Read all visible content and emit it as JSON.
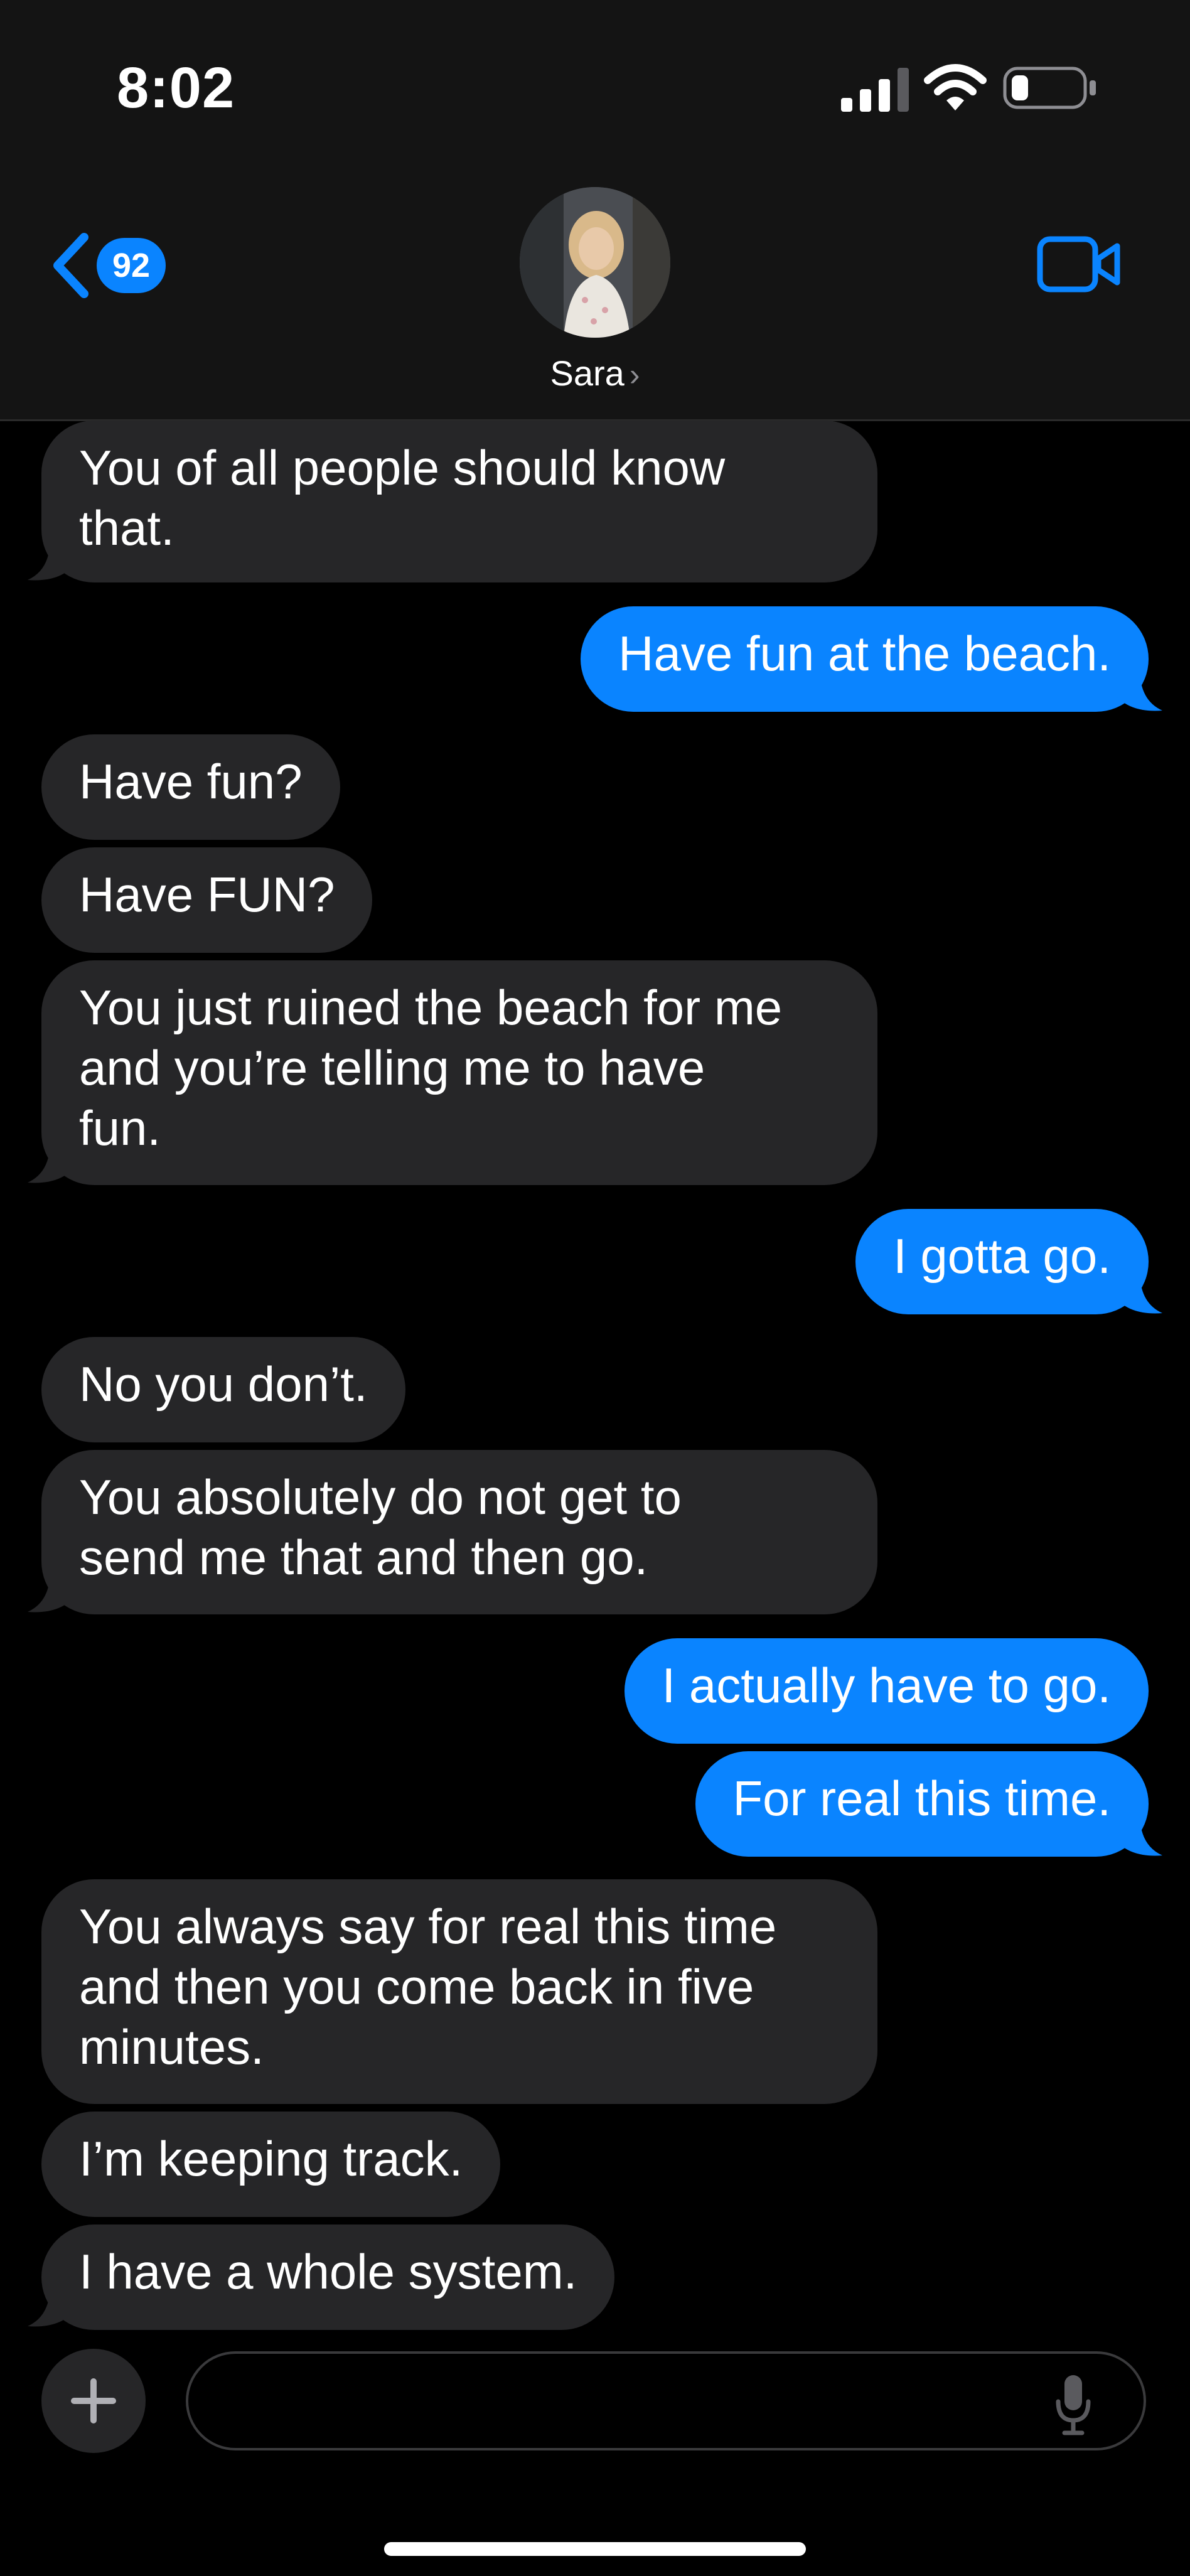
{
  "status_bar": {
    "time": "8:02",
    "icons": [
      "cellular-signal-icon",
      "wifi-icon",
      "battery-icon"
    ]
  },
  "header": {
    "back_badge_count": "92",
    "contact_name": "Sara",
    "chevron": "›",
    "video_call_icon": "video-camera-icon"
  },
  "colors": {
    "outgoing_bubble": "#0a84ff",
    "incoming_bubble": "#262628",
    "accent": "#0a84ff",
    "background": "#000000"
  },
  "messages": [
    {
      "sender": "them",
      "text": "You of all people should know that.",
      "lines": [
        "You of all people should know",
        "that."
      ]
    },
    {
      "sender": "me",
      "text": "Have fun at the beach."
    },
    {
      "sender": "them",
      "text": "Have fun?"
    },
    {
      "sender": "them",
      "text": "Have FUN?"
    },
    {
      "sender": "them",
      "text": "You just ruined the beach for me and you’re telling me to have fun.",
      "lines": [
        "You just ruined the beach for me",
        "and you’re telling me to have",
        "fun."
      ]
    },
    {
      "sender": "me",
      "text": "I gotta go."
    },
    {
      "sender": "them",
      "text": "No you don’t."
    },
    {
      "sender": "them",
      "text": "You absolutely do not get to send me that and then go.",
      "lines": [
        "You absolutely do not get to",
        "send me that and then go."
      ]
    },
    {
      "sender": "me",
      "text": "I actually have to go."
    },
    {
      "sender": "me",
      "text": "For real this time."
    },
    {
      "sender": "them",
      "text": "You always say for real this time and then you come back in five minutes.",
      "lines": [
        "You always say for real this time",
        "and then you come back in five",
        "minutes."
      ]
    },
    {
      "sender": "them",
      "text": "I’m keeping track."
    },
    {
      "sender": "them",
      "text": "I have a whole system."
    }
  ],
  "input": {
    "placeholder": "",
    "value": "",
    "add_icon": "plus-icon",
    "mic_icon": "microphone-icon"
  }
}
